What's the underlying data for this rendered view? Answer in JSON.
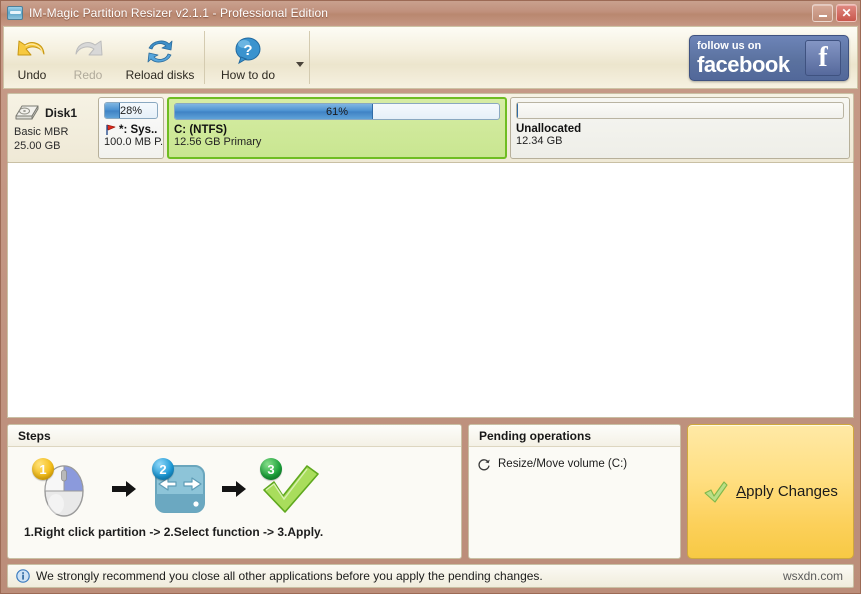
{
  "window": {
    "title": "IM-Magic Partition Resizer v2.1.1 - Professional Edition",
    "minimize_label": "Minimize",
    "close_label": "Close"
  },
  "toolbar": {
    "undo": "Undo",
    "redo": "Redo",
    "reload": "Reload disks",
    "howto": "How to do",
    "facebook_small": "follow us on",
    "facebook_big": "facebook",
    "facebook_logo": "f"
  },
  "disk": {
    "name": "Disk1",
    "type": "Basic MBR",
    "size": "25.00 GB"
  },
  "partitions": [
    {
      "label": "*: Sys...",
      "sub": "100.0 MB P.",
      "percent": 28,
      "percent_text": "28%",
      "selected": false,
      "kind": "system"
    },
    {
      "label": "C: (NTFS)",
      "sub": "12.56 GB Primary",
      "percent": 61,
      "percent_text": "61%",
      "selected": true,
      "kind": "ntfs"
    },
    {
      "label": "Unallocated",
      "sub": "12.34 GB",
      "percent": 0,
      "percent_text": "",
      "selected": false,
      "kind": "unallocated"
    }
  ],
  "steps": {
    "title": "Steps",
    "caption": "1.Right click partition -> 2.Select function -> 3.Apply.",
    "badges": [
      "1",
      "2",
      "3"
    ]
  },
  "pending": {
    "title": "Pending operations",
    "items": [
      {
        "text": "Resize/Move volume (C:)"
      }
    ]
  },
  "apply": {
    "label_prefix": "A",
    "label_rest": "pply Changes"
  },
  "status": {
    "message": "We strongly recommend you close all other applications before you apply the pending changes.",
    "watermark": "wsxdn.com"
  },
  "colors": {
    "title_bar": "#c0907c",
    "accent_green": "#6fbd22",
    "partition_fill": "#4a90d0",
    "apply_gold": "#fcd05a",
    "facebook_blue": "#5b729f"
  }
}
